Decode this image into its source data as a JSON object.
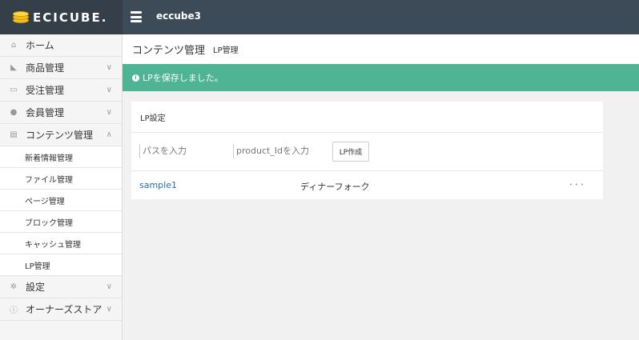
{
  "header": {
    "logo_text": "ECICUBE.",
    "shop_name": "eccube3"
  },
  "sidebar": {
    "items": [
      {
        "label": "ホーム",
        "icon": "home-icon",
        "glyph": "⌂"
      },
      {
        "label": "商品管理",
        "icon": "tag-icon",
        "glyph": "◣"
      },
      {
        "label": "受注管理",
        "icon": "cart-icon",
        "glyph": "▭"
      },
      {
        "label": "会員管理",
        "icon": "users-icon",
        "glyph": "●"
      },
      {
        "label": "コンテンツ管理",
        "icon": "file-icon",
        "glyph": "▤"
      }
    ],
    "subitems": [
      "新着情報管理",
      "ファイル管理",
      "ページ管理",
      "ブロック管理",
      "キャッシュ管理",
      "LP管理"
    ],
    "bottom_items": [
      {
        "label": "設定",
        "icon": "gear-icon",
        "glyph": "✲"
      },
      {
        "label": "オーナーズストア",
        "icon": "info-circle-icon",
        "glyph": "ⓘ"
      }
    ]
  },
  "page": {
    "title": "コンテンツ管理",
    "subtitle": "LP管理"
  },
  "alert": {
    "message": "LPを保存しました。"
  },
  "card": {
    "title": "LP設定",
    "path_placeholder": "パスを入力",
    "product_placeholder": "product_Idを入力",
    "create_button": "LP作成",
    "rows": [
      {
        "link": "sample1",
        "name": "ディナーフォーク",
        "more": "･･･"
      }
    ]
  },
  "colors": {
    "topbar": "#3d4a57",
    "alert": "#4fb493",
    "link": "#2a6ead"
  }
}
